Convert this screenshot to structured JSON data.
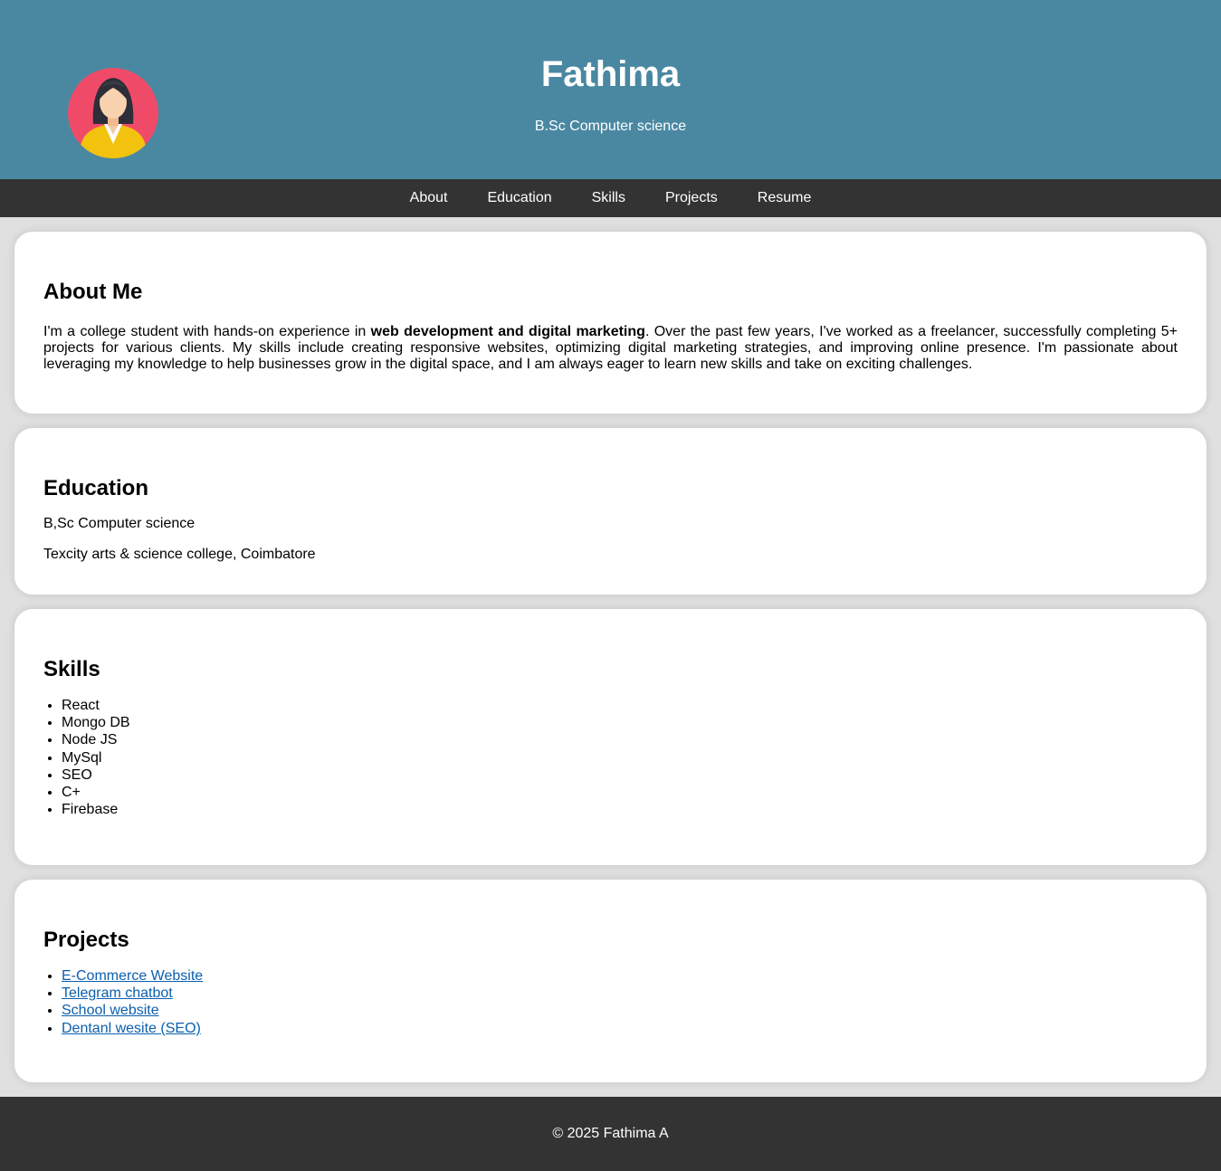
{
  "header": {
    "name": "Fathima",
    "subtitle": "B.Sc Computer science",
    "avatar_icon": "woman-avatar-icon",
    "colors": {
      "background": "#4a88a2",
      "avatar_bg": "#ef4b68",
      "avatar_shirt": "#f2c20f"
    }
  },
  "nav": {
    "items": [
      "About",
      "Education",
      "Skills",
      "Projects",
      "Resume"
    ]
  },
  "about": {
    "title": "About Me",
    "text_before": "I'm a college student with hands-on experience in ",
    "text_bold": "web development and digital marketing",
    "text_after": ". Over the past few years, I've worked as a freelancer, successfully completing 5+ projects for various clients. My skills include creating responsive websites, optimizing digital marketing strategies, and improving online presence. I'm passionate about leveraging my knowledge to help businesses grow in the digital space, and I am always eager to learn new skills and take on exciting challenges."
  },
  "education": {
    "title": "Education",
    "degree": "B,Sc Computer science",
    "college": "Texcity arts & science college, Coimbatore"
  },
  "skills": {
    "title": "Skills",
    "items": [
      "React",
      "Mongo DB",
      "Node JS",
      "MySql",
      "SEO",
      "C+",
      "Firebase"
    ]
  },
  "projects": {
    "title": "Projects",
    "items": [
      "E-Commerce Website",
      "Telegram chatbot",
      "School website",
      "Dentanl wesite (SEO)"
    ]
  },
  "footer": {
    "text": "© 2025 Fathima A",
    "color": "#333333"
  }
}
